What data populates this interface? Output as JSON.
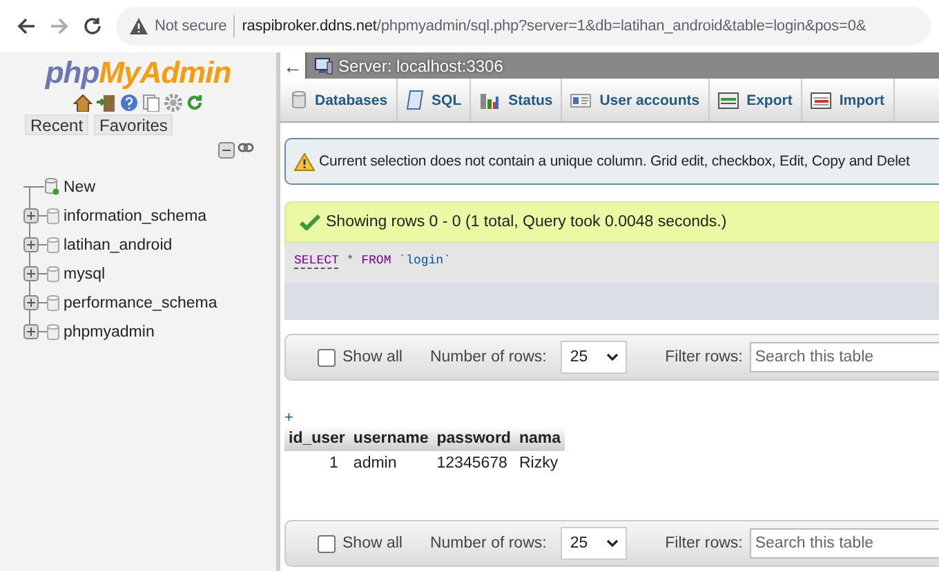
{
  "browser": {
    "security": "Not secure",
    "url_host": "raspibroker.ddns.net",
    "url_path": "/phpmyadmin/sql.php?server=1&db=latihan_android&table=login&pos=0&"
  },
  "sidebar": {
    "logo": [
      "php",
      "MyAdmin"
    ],
    "buttons": [
      "Recent",
      "Favorites"
    ],
    "tree": [
      {
        "label": "New",
        "kind": "new"
      },
      {
        "label": "information_schema",
        "kind": "database"
      },
      {
        "label": "latihan_android",
        "kind": "database"
      },
      {
        "label": "mysql",
        "kind": "database"
      },
      {
        "label": "performance_schema",
        "kind": "database"
      },
      {
        "label": "phpmyadmin",
        "kind": "database"
      }
    ]
  },
  "main": {
    "collapse": "←",
    "server": "Server: localhost:3306",
    "tabs": [
      {
        "label": "Databases"
      },
      {
        "label": "SQL"
      },
      {
        "label": "Status"
      },
      {
        "label": "User accounts"
      },
      {
        "label": "Export"
      },
      {
        "label": "Import"
      }
    ],
    "notices": [
      {
        "kind": "warning",
        "text": "Current selection does not contain a unique column. Grid edit, checkbox, Edit, Copy and Delet"
      },
      {
        "kind": "success",
        "text": "Showing rows 0 - 0 (1 total, Query took 0.0048 seconds.)"
      }
    ],
    "sql": [
      {
        "kind": "keyword",
        "text": "SELECT"
      },
      {
        "kind": "plain",
        "text": "*"
      },
      {
        "kind": "keyword2",
        "text": "FROM"
      },
      {
        "kind": "name",
        "text": "`login`"
      }
    ],
    "nav_bars": [
      {
        "show_all": "Show all",
        "checked": false,
        "rows_label": "Number of rows:",
        "rows_value": "25",
        "filter_label": "Filter rows:",
        "placeholder": "Search this table"
      },
      {
        "show_all": "Show all",
        "checked": false,
        "rows_label": "Number of rows:",
        "rows_value": "25",
        "filter_label": "Filter rows:",
        "placeholder": "Search this table"
      }
    ],
    "table": {
      "expand": "+",
      "columns": [
        "id_user",
        "username",
        "password",
        "nama"
      ],
      "rows": [
        [
          "1",
          "admin",
          "12345678",
          "Rizky"
        ]
      ]
    }
  }
}
